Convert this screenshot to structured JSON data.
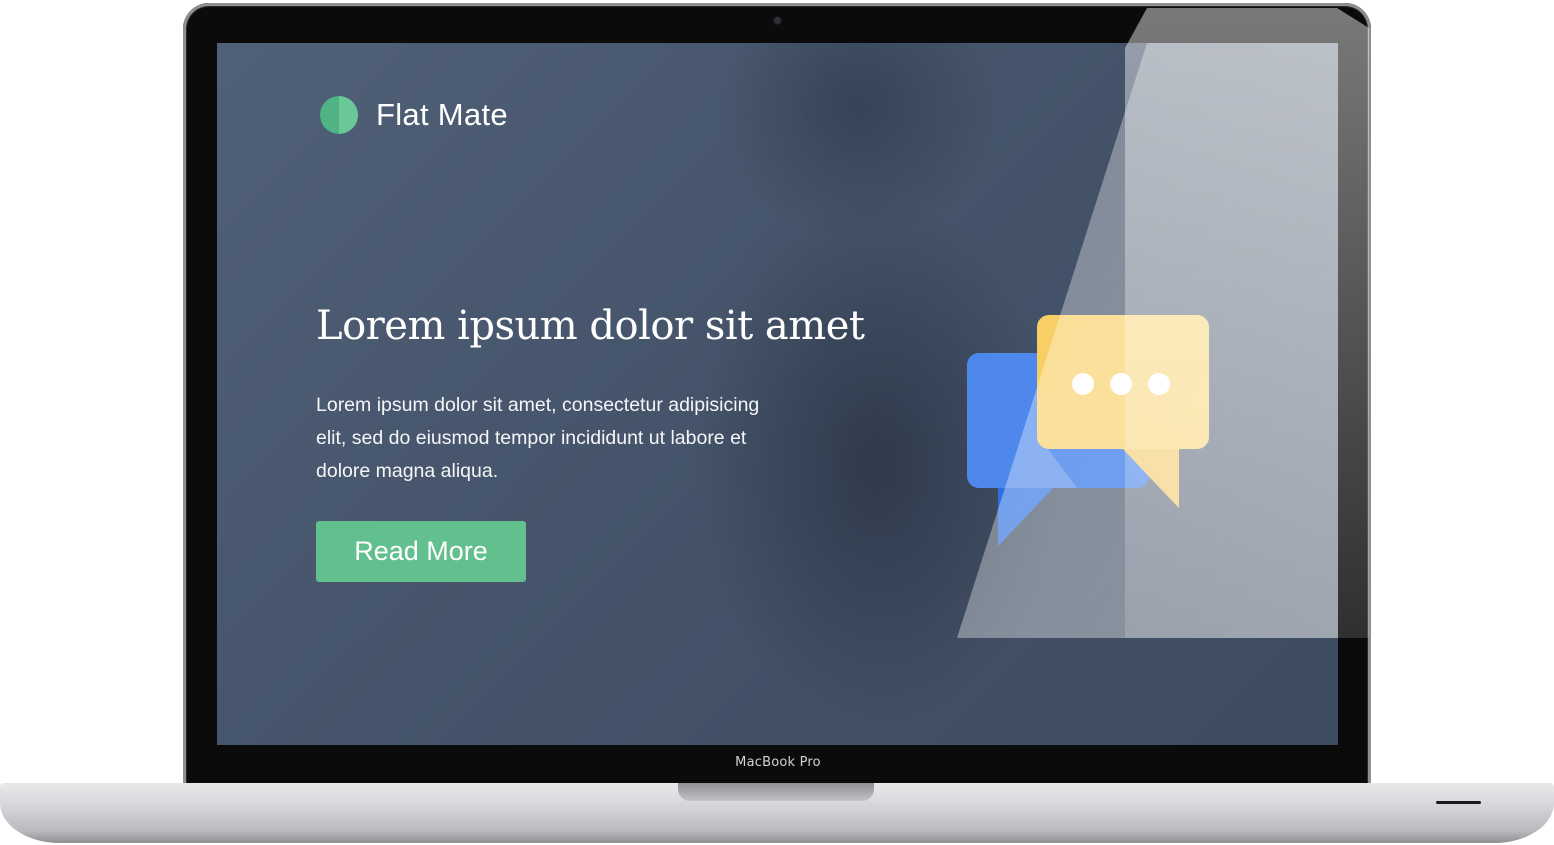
{
  "device": {
    "model_label": "MacBook Pro"
  },
  "site": {
    "brand_name": "Flat Mate",
    "hero": {
      "headline": "Lorem ipsum dolor sit amet",
      "body": "Lorem ipsum dolor sit amet, consectetur adipisicing elit, sed do eiusmod tempor incididunt ut labore et dolore magna aliqua.",
      "cta_label": "Read More"
    },
    "icons": {
      "logo": "circle-logo-icon",
      "illustration": "chat-bubbles-icon"
    }
  },
  "colors": {
    "accent_green": "#62bf8e",
    "screen_bg": "#45546a",
    "bubble_blue": "#4f88ec",
    "bubble_yellow": "#f7cf64"
  }
}
